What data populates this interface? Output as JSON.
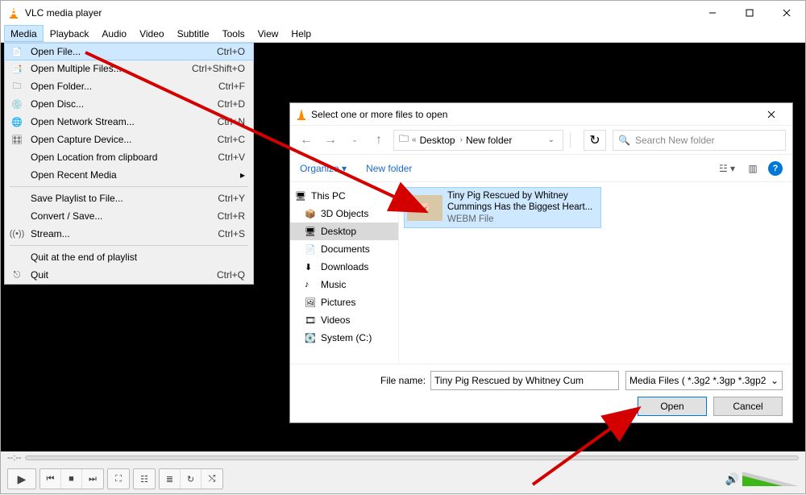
{
  "window": {
    "title": "VLC media player"
  },
  "menubar": [
    "Media",
    "Playback",
    "Audio",
    "Video",
    "Subtitle",
    "Tools",
    "View",
    "Help"
  ],
  "media_menu": [
    {
      "icon": "📄",
      "label": "Open File...",
      "shortcut": "Ctrl+O",
      "hl": true
    },
    {
      "icon": "📑",
      "label": "Open Multiple Files...",
      "shortcut": "Ctrl+Shift+O"
    },
    {
      "icon": "🗀",
      "label": "Open Folder...",
      "shortcut": "Ctrl+F"
    },
    {
      "icon": "💿",
      "label": "Open Disc...",
      "shortcut": "Ctrl+D"
    },
    {
      "icon": "🌐",
      "label": "Open Network Stream...",
      "shortcut": "Ctrl+N"
    },
    {
      "icon": "🎛",
      "label": "Open Capture Device...",
      "shortcut": "Ctrl+C"
    },
    {
      "icon": "",
      "label": "Open Location from clipboard",
      "shortcut": "Ctrl+V"
    },
    {
      "icon": "",
      "label": "Open Recent Media",
      "shortcut": "",
      "sub": true
    },
    {
      "sep": true
    },
    {
      "icon": "",
      "label": "Save Playlist to File...",
      "shortcut": "Ctrl+Y"
    },
    {
      "icon": "",
      "label": "Convert / Save...",
      "shortcut": "Ctrl+R"
    },
    {
      "icon": "((•))",
      "label": "Stream...",
      "shortcut": "Ctrl+S"
    },
    {
      "sep": true
    },
    {
      "icon": "",
      "label": "Quit at the end of playlist",
      "shortcut": ""
    },
    {
      "icon": "⎋",
      "label": "Quit",
      "shortcut": "Ctrl+Q"
    }
  ],
  "dialog": {
    "title": "Select one or more files to open",
    "breadcrumb": [
      "Desktop",
      "New folder"
    ],
    "search_placeholder": "Search New folder",
    "organize": "Organize",
    "new_folder": "New folder",
    "tree_top": "This PC",
    "tree": [
      {
        "icon": "📦",
        "label": "3D Objects"
      },
      {
        "icon": "🖥",
        "label": "Desktop",
        "sel": true
      },
      {
        "icon": "📄",
        "label": "Documents"
      },
      {
        "icon": "⬇",
        "label": "Downloads"
      },
      {
        "icon": "♪",
        "label": "Music"
      },
      {
        "icon": "🖼",
        "label": "Pictures"
      },
      {
        "icon": "🎞",
        "label": "Videos"
      },
      {
        "icon": "💽",
        "label": "System (C:)"
      }
    ],
    "file": {
      "name": "Tiny Pig Rescued by Whitney Cummings Has the Biggest Heart...",
      "type": "WEBM File"
    },
    "filename_label": "File name:",
    "filename_value": "Tiny Pig Rescued by Whitney Cum",
    "filetype": "Media Files ( *.3g2 *.3gp *.3gp2",
    "open": "Open",
    "cancel": "Cancel"
  },
  "seekbar": {
    "pos": "--:--"
  }
}
